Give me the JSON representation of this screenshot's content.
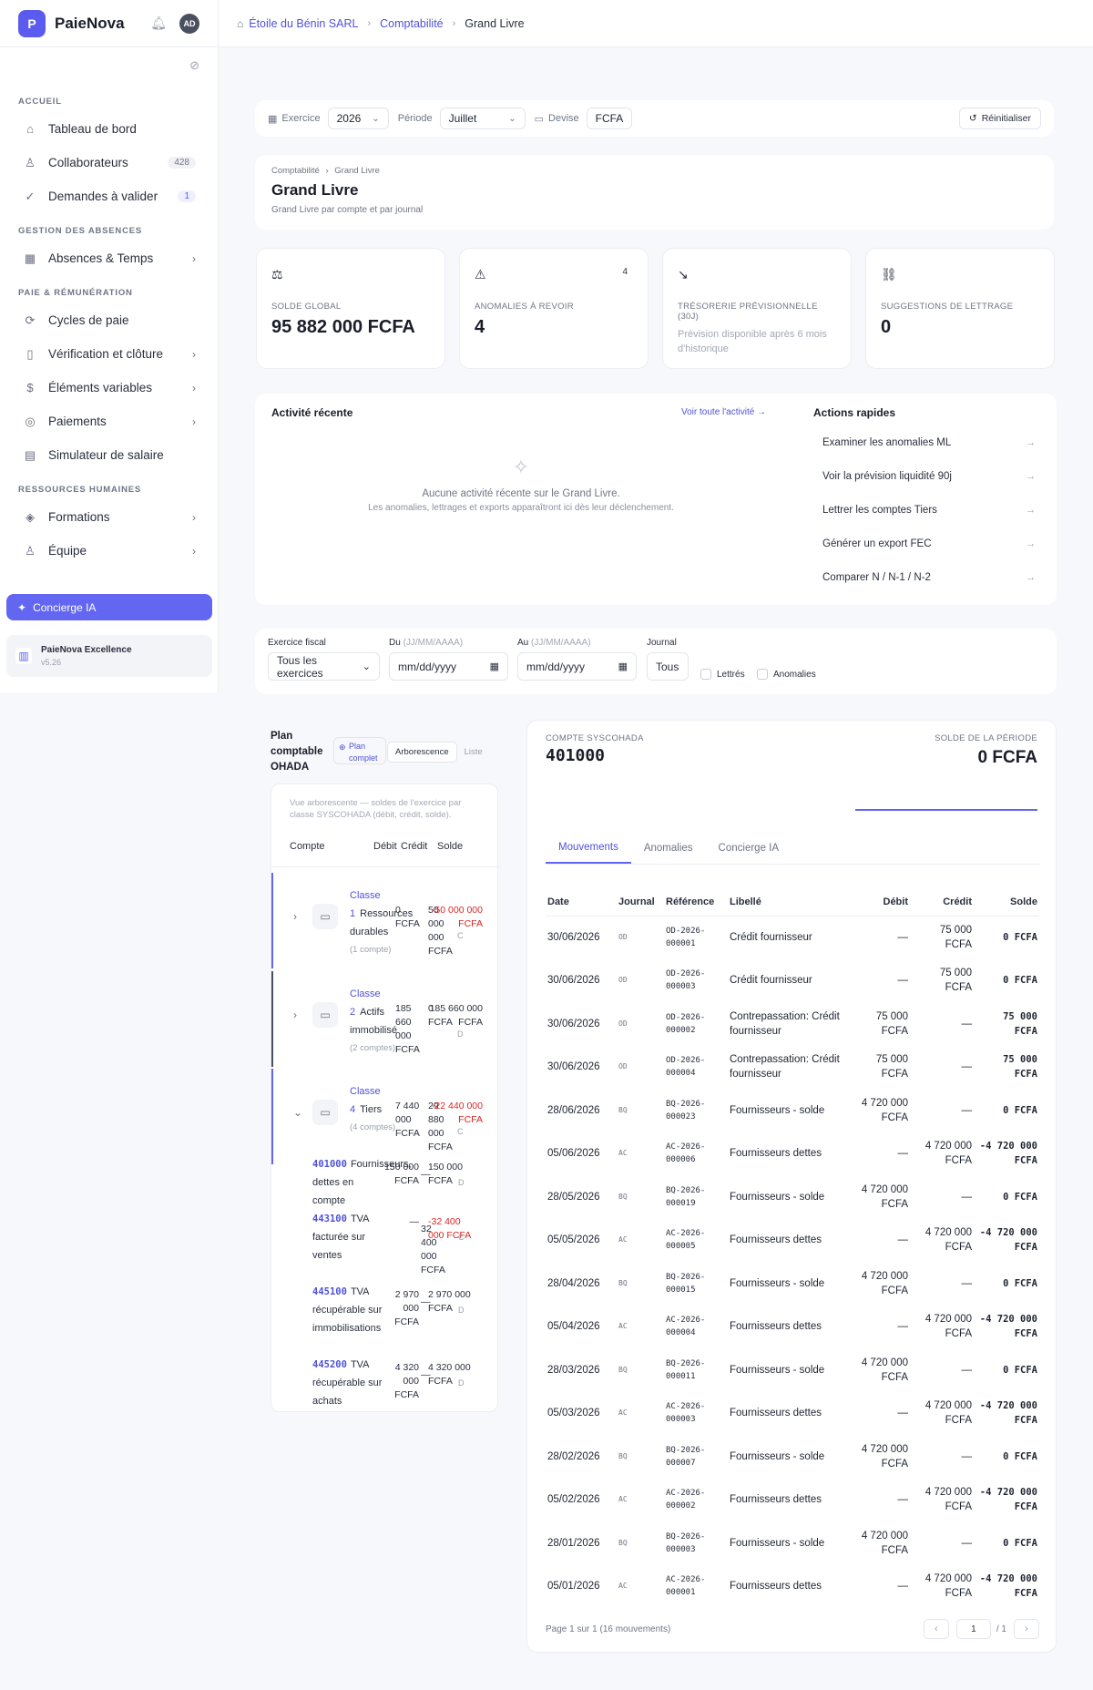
{
  "app": {
    "name": "PaieNova",
    "logo": "P",
    "avatar": "AD"
  },
  "breadcrumb": [
    "Étoile du Bénin SARL",
    "Comptabilité",
    "Grand Livre"
  ],
  "sidebar": {
    "sections": [
      {
        "title": "ACCUEIL",
        "items": [
          {
            "label": "Tableau de bord",
            "icon": "home-icon",
            "glyph": "⌂"
          },
          {
            "label": "Collaborateurs",
            "icon": "users-icon",
            "glyph": "♙",
            "count": "428"
          },
          {
            "label": "Demandes à valider",
            "icon": "check-circle-icon",
            "glyph": "✓",
            "count": "1"
          }
        ]
      },
      {
        "title": "GESTION DES ABSENCES",
        "items": [
          {
            "label": "Absences & Temps",
            "icon": "calendar-icon",
            "glyph": "▦",
            "chevron": true
          }
        ]
      },
      {
        "title": "PAIE & RÉMUNÉRATION",
        "items": [
          {
            "label": "Cycles de paie",
            "icon": "cycle-icon",
            "glyph": "⟳"
          },
          {
            "label": "Vérification et clôture",
            "icon": "file-check-icon",
            "glyph": "▯",
            "chevron": true
          },
          {
            "label": "Éléments variables",
            "icon": "dollar-icon",
            "glyph": "$",
            "chevron": true
          },
          {
            "label": "Paiements",
            "icon": "coin-icon",
            "glyph": "◎",
            "chevron": true
          },
          {
            "label": "Simulateur de salaire",
            "icon": "calculator-icon",
            "glyph": "▤"
          }
        ]
      },
      {
        "title": "RESSOURCES HUMAINES",
        "items": [
          {
            "label": "Formations",
            "icon": "graduation-icon",
            "glyph": "◈",
            "chevron": true
          },
          {
            "label": "Équipe",
            "icon": "team-icon",
            "glyph": "♙",
            "chevron": true
          }
        ]
      }
    ],
    "concierge": "Concierge IA",
    "version_name": "PaieNova Excellence",
    "version": "v5.26"
  },
  "filters": {
    "exercice_label": "Exercice",
    "exercice": "2026",
    "periode_label": "Période",
    "periode": "Juillet",
    "devise_label": "Devise",
    "devise": "FCFA",
    "reset": "Réinitialiser"
  },
  "header": {
    "crumb1": "Comptabilité",
    "crumb2": "Grand Livre",
    "title": "Grand Livre",
    "subtitle": "Grand Livre par compte et par journal"
  },
  "kpis": [
    {
      "label": "SOLDE GLOBAL",
      "value": "95 882 000 FCFA",
      "icon": "scale-icon",
      "glyph": "⚖"
    },
    {
      "label": "ANOMALIES À REVOIR",
      "value": "4",
      "icon": "warning-icon",
      "glyph": "⚠",
      "badge": "4"
    },
    {
      "label": "TRÉSORERIE PRÉVISIONNELLE (30J)",
      "note": "Prévision disponible après 6 mois d'historique",
      "icon": "trend-down-icon",
      "glyph": "↘"
    },
    {
      "label": "SUGGESTIONS DE LETTRAGE",
      "value": "0",
      "icon": "link-icon",
      "glyph": "⛓"
    }
  ],
  "activity": {
    "title": "Activité récente",
    "link": "Voir toute l'activité →",
    "empty_title": "Aucune activité récente sur le Grand Livre.",
    "empty_sub": "Les anomalies, lettrages et exports apparaîtront ici dès leur déclenchement."
  },
  "quick_actions": {
    "title": "Actions rapides",
    "items": [
      "Examiner les anomalies ML",
      "Voir la prévision liquidité 90j",
      "Lettrer les comptes Tiers",
      "Générer un export FEC",
      "Comparer N / N-1 / N-2"
    ]
  },
  "filters2": {
    "fiscal_label": "Exercice fiscal",
    "fiscal_value": "Tous les exercices",
    "du_label": "Du",
    "au_label": "Au",
    "date_hint": "(JJ/MM/AAAA)",
    "date_placeholder": "mm/dd/yyyy",
    "journal_label": "Journal",
    "journal_value": "Tous",
    "lettres": "Lettrés",
    "anomalies": "Anomalies"
  },
  "tree": {
    "title": "Plan comptable OHADA",
    "plan_badge": "Plan complet",
    "view_tree": "Arborescence",
    "view_list": "Liste",
    "hint": "Vue arborescente — soldes de l'exercice par classe SYSCOHADA (débit, crédit, solde).",
    "headers": {
      "compte": "Compte",
      "debit": "Débit",
      "credit": "Crédit",
      "solde": "Solde"
    },
    "classes": [
      {
        "label": "Classe",
        "num": "1",
        "name": "Ressources durables",
        "count": "(1 compte)",
        "debit": "0 FCFA",
        "credit": "50 000 000 FCFA",
        "solde": "-50 000 000 FCFA",
        "dc": "C",
        "bar": "#6366f1",
        "open": false
      },
      {
        "label": "Classe",
        "num": "2",
        "name": "Actifs immobilisé",
        "count": "(2 comptes)",
        "debit": "185 660 000 FCFA",
        "credit": "0 FCFA",
        "solde": "185 660 000 FCFA",
        "dc": "D",
        "bar": "#4b5060",
        "open": false
      },
      {
        "label": "Classe",
        "num": "4",
        "name": "Tiers",
        "count": "(4 comptes)",
        "debit": "7 440 000 FCFA",
        "credit": "29 880 000 FCFA",
        "solde": "-22 440 000 FCFA",
        "dc": "C",
        "bar": "#6366f1",
        "open": true
      }
    ],
    "accounts": [
      {
        "code": "401000",
        "name": "Fournisseurs, dettes en compte",
        "debit": "150 000 FCFA",
        "credit": "—",
        "solde": "150 000 FCFA",
        "dc": "D"
      },
      {
        "code": "443100",
        "name": "TVA facturée sur ventes",
        "debit": "—",
        "credit": "32 400 000 FCFA",
        "solde": "-32 400 000 FCFA",
        "dc": "C"
      },
      {
        "code": "445100",
        "name": "TVA récupérable sur immobilisations",
        "debit": "2 970 000 FCFA",
        "credit": "—",
        "solde": "2 970 000 FCFA",
        "dc": "D"
      },
      {
        "code": "445200",
        "name": "TVA récupérable sur achats",
        "debit": "4 320 000 FCFA",
        "credit": "—",
        "solde": "4 320 000 FCFA",
        "dc": "D"
      }
    ]
  },
  "detail": {
    "account_label": "COMPTE SYSCOHADA",
    "account": "401000",
    "solde_label": "SOLDE DE LA PÉRIODE",
    "solde": "0 FCFA",
    "tabs": [
      "Mouvements",
      "Anomalies",
      "Concierge IA"
    ],
    "columns": [
      "Date",
      "Journal",
      "Référence",
      "Libellé",
      "Débit",
      "Crédit",
      "Solde"
    ],
    "rows": [
      {
        "date": "30/06/2026",
        "journal": "OD",
        "ref": "OD-2026-000001",
        "libelle": "Crédit fournisseur",
        "debit": "—",
        "credit": "75 000 FCFA",
        "solde": "0 FCFA"
      },
      {
        "date": "30/06/2026",
        "journal": "OD",
        "ref": "OD-2026-000003",
        "libelle": "Crédit fournisseur",
        "debit": "—",
        "credit": "75 000 FCFA",
        "solde": "0 FCFA"
      },
      {
        "date": "30/06/2026",
        "journal": "OD",
        "ref": "OD-2026-000002",
        "libelle": "Contrepassation: Crédit fournisseur",
        "debit": "75 000 FCFA",
        "credit": "—",
        "solde": "75 000 FCFA"
      },
      {
        "date": "30/06/2026",
        "journal": "OD",
        "ref": "OD-2026-000004",
        "libelle": "Contrepassation: Crédit fournisseur",
        "debit": "75 000 FCFA",
        "credit": "—",
        "solde": "75 000 FCFA"
      },
      {
        "date": "28/06/2026",
        "journal": "BQ",
        "ref": "BQ-2026-000023",
        "libelle": "Fournisseurs - solde",
        "debit": "4 720 000 FCFA",
        "credit": "—",
        "solde": "0 FCFA"
      },
      {
        "date": "05/06/2026",
        "journal": "AC",
        "ref": "AC-2026-000006",
        "libelle": "Fournisseurs dettes",
        "debit": "—",
        "credit": "4 720 000 FCFA",
        "solde": "-4 720 000 FCFA"
      },
      {
        "date": "28/05/2026",
        "journal": "BQ",
        "ref": "BQ-2026-000019",
        "libelle": "Fournisseurs - solde",
        "debit": "4 720 000 FCFA",
        "credit": "—",
        "solde": "0 FCFA"
      },
      {
        "date": "05/05/2026",
        "journal": "AC",
        "ref": "AC-2026-000005",
        "libelle": "Fournisseurs dettes",
        "debit": "—",
        "credit": "4 720 000 FCFA",
        "solde": "-4 720 000 FCFA"
      },
      {
        "date": "28/04/2026",
        "journal": "BQ",
        "ref": "BQ-2026-000015",
        "libelle": "Fournisseurs - solde",
        "debit": "4 720 000 FCFA",
        "credit": "—",
        "solde": "0 FCFA"
      },
      {
        "date": "05/04/2026",
        "journal": "AC",
        "ref": "AC-2026-000004",
        "libelle": "Fournisseurs dettes",
        "debit": "—",
        "credit": "4 720 000 FCFA",
        "solde": "-4 720 000 FCFA"
      },
      {
        "date": "28/03/2026",
        "journal": "BQ",
        "ref": "BQ-2026-000011",
        "libelle": "Fournisseurs - solde",
        "debit": "4 720 000 FCFA",
        "credit": "—",
        "solde": "0 FCFA"
      },
      {
        "date": "05/03/2026",
        "journal": "AC",
        "ref": "AC-2026-000003",
        "libelle": "Fournisseurs dettes",
        "debit": "—",
        "credit": "4 720 000 FCFA",
        "solde": "-4 720 000 FCFA"
      },
      {
        "date": "28/02/2026",
        "journal": "BQ",
        "ref": "BQ-2026-000007",
        "libelle": "Fournisseurs - solde",
        "debit": "4 720 000 FCFA",
        "credit": "—",
        "solde": "0 FCFA"
      },
      {
        "date": "05/02/2026",
        "journal": "AC",
        "ref": "AC-2026-000002",
        "libelle": "Fournisseurs dettes",
        "debit": "—",
        "credit": "4 720 000 FCFA",
        "solde": "-4 720 000 FCFA"
      },
      {
        "date": "28/01/2026",
        "journal": "BQ",
        "ref": "BQ-2026-000003",
        "libelle": "Fournisseurs - solde",
        "debit": "4 720 000 FCFA",
        "credit": "—",
        "solde": "0 FCFA"
      },
      {
        "date": "05/01/2026",
        "journal": "AC",
        "ref": "AC-2026-000001",
        "libelle": "Fournisseurs dettes",
        "debit": "—",
        "credit": "4 720 000 FCFA",
        "solde": "-4 720 000 FCFA"
      }
    ],
    "pager_text": "Page 1 sur 1 (16 mouvements)",
    "page": "1",
    "page_total": "/ 1"
  }
}
